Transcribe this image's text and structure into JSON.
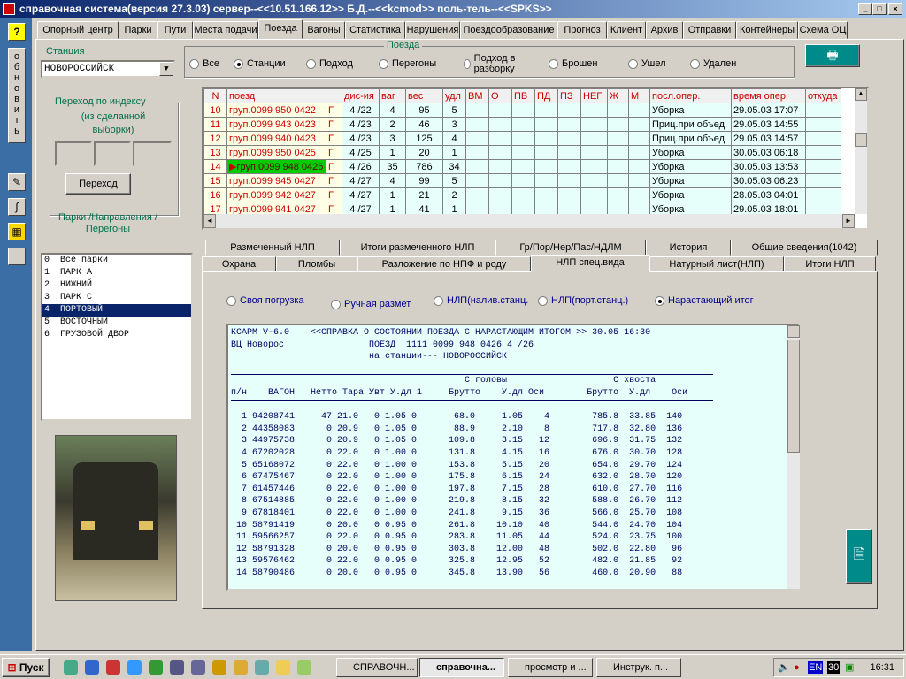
{
  "window": {
    "title": "справочная система(версия 27.3.03) сервер--<<10.51.166.12>> Б.Д.--<<kcmod>> поль-тель--<<SPKS>>",
    "min": "_",
    "max": "□",
    "close": "×"
  },
  "leftbar": {
    "help": "?",
    "refresh": "обновить"
  },
  "tabs": [
    "Опорный центр",
    "Парки",
    "Пути",
    "Места подачи",
    "Поезда",
    "Вагоны",
    "Статистика",
    "Нарушения",
    "Поездообразование",
    "Прогноз",
    "Клиент",
    "Архив",
    "Отправки",
    "Контейнеры",
    "Схема ОЦ"
  ],
  "station": {
    "label": "Станция",
    "value": "НОВОРОССИЙСК"
  },
  "trains_group": {
    "label": "Поезда",
    "options": [
      "Все",
      "Станции",
      "Подход",
      "Перегоны",
      "Подход в разборку",
      "Брошен",
      "Ушел",
      "Удален"
    ],
    "selected": "Станции"
  },
  "goto": {
    "title": "Переход  по индексу",
    "subtitle": "(из сделанной выборки)",
    "button": "Переход"
  },
  "parks": {
    "label": "Парки /Направления / Перегоны",
    "items": [
      "0  Все парки",
      "1  ПАРК А",
      "2  НИЖНИЙ",
      "3  ПАРК С",
      "4  ПОРТОВЫЙ",
      "5  ВОСТОЧНЫЙ",
      "6  ГРУЗОВОЙ ДВОР"
    ],
    "selected": 4
  },
  "grid": {
    "headers": [
      "N",
      "поезд",
      "",
      "дис-ия",
      "ваг",
      "вес",
      "удл",
      "ВМ",
      "О",
      "ПВ",
      "ПД",
      "ПЗ",
      "НЕГ",
      "Ж",
      "М",
      "посл.опер.",
      "время опер.",
      "откуда"
    ],
    "rows": [
      [
        "10",
        "груп.0099 950 0422",
        "Г",
        "4 /22",
        "4",
        "95",
        "5",
        "Уборка",
        "29.05.03 17:07"
      ],
      [
        "11",
        "груп.0099 943 0423",
        "Г",
        "4 /23",
        "2",
        "46",
        "3",
        "Приц.при объед.",
        "29.05.03 14:55"
      ],
      [
        "12",
        "груп.0099 940 0423",
        "Г",
        "4 /23",
        "3",
        "125",
        "4",
        "Приц.при объед.",
        "29.05.03 14:57"
      ],
      [
        "13",
        "груп.0099 950 0425",
        "Г",
        "4 /25",
        "1",
        "20",
        "1",
        "Уборка",
        "30.05.03 06:18"
      ],
      [
        "14",
        "груп.0099 948 0426",
        "Г",
        "4 /26",
        "35",
        "786",
        "34",
        "Уборка",
        "30.05.03 13:53"
      ],
      [
        "15",
        "груп.0099 945 0427",
        "Г",
        "4 /27",
        "4",
        "99",
        "5",
        "Уборка",
        "30.05.03 06:23"
      ],
      [
        "16",
        "груп.0099 942 0427",
        "Г",
        "4 /27",
        "1",
        "21",
        "2",
        "Уборка",
        "28.05.03 04:01"
      ],
      [
        "17",
        "груп.0099 941 0427",
        "Г",
        "4 /27",
        "1",
        "41",
        "1",
        "Уборка",
        "29.05.03 18:01"
      ]
    ],
    "selected_row": 4
  },
  "subtabs_top": [
    "Размеченный НЛП",
    "Итоги размеченного НЛП",
    "Гр/Пор/Нер/Пас/НДЛМ",
    "История",
    "Общие сведения(1042)"
  ],
  "subtabs_bottom": [
    "Охрана",
    "Пломбы",
    "Разложение по НПФ и роду",
    "НЛП спец.вида",
    "Натурный лист(НЛП)",
    "Итоги НЛП"
  ],
  "nlp_options": {
    "options": [
      "Своя погрузка",
      "Ручная размет",
      "НЛП(налив.станц.",
      "НЛП(порт.станц.)",
      "Нарастающий итог"
    ],
    "selected": "Нарастающий итог"
  },
  "report": {
    "lines": [
      "КСАРМ V-6.0    <<СПРАВКА О СОСТОЯНИИ ПОЕЗДА С НАРАСТАЮЩИМ ИТОГОМ >> 30.05 16:30",
      "ВЦ Новорос                ПОЕЗД  1111 0099 948 0426 4 /26",
      "                          на станции--- НОВОРОССИЙСК",
      "                                                                       ",
      "                                            С головы                    С хвоста",
      "п/н    ВАГОН   Нетто Тара Увт У.дл 1     Брутто    У.дл Оси        Брутто  У.дл    Оси",
      "",
      "  1 94208741     47 21.0   0 1.05 0       68.0     1.05    4        785.8  33.85  140",
      "  2 44358083      0 20.9   0 1.05 0       88.9     2.10    8        717.8  32.80  136",
      "  3 44975738      0 20.9   0 1.05 0      109.8     3.15   12        696.9  31.75  132",
      "  4 67202028      0 22.0   0 1.00 0      131.8     4.15   16        676.0  30.70  128",
      "  5 65168072      0 22.0   0 1.00 0      153.8     5.15   20        654.0  29.70  124",
      "  6 67475467      0 22.0   0 1.00 0      175.8     6.15   24        632.0  28.70  120",
      "  7 61457446      0 22.0   0 1.00 0      197.8     7.15   28        610.0  27.70  116",
      "  8 67514885      0 22.0   0 1.00 0      219.8     8.15   32        588.0  26.70  112",
      "  9 67818401      0 22.0   0 1.00 0      241.8     9.15   36        566.0  25.70  108",
      " 10 58791419      0 20.0   0 0.95 0      261.8    10.10   40        544.0  24.70  104",
      " 11 59566257      0 22.0   0 0.95 0      283.8    11.05   44        524.0  23.75  100",
      " 12 58791328      0 20.0   0 0.95 0      303.8    12.00   48        502.0  22.80   96",
      " 13 59576462      0 22.0   0 0.95 0      325.8    12.95   52        482.0  21.85   92",
      " 14 58790486      0 20.0   0 0.95 0      345.8    13.90   56        460.0  20.90   88"
    ]
  },
  "taskbar": {
    "start": "Пуск",
    "tasks": [
      "СПРАВОЧН...",
      "справочна...",
      "просмотр и ...",
      "Инструк. п..."
    ],
    "active": 1,
    "lang": "EN",
    "day": "30",
    "time": "16:31"
  }
}
